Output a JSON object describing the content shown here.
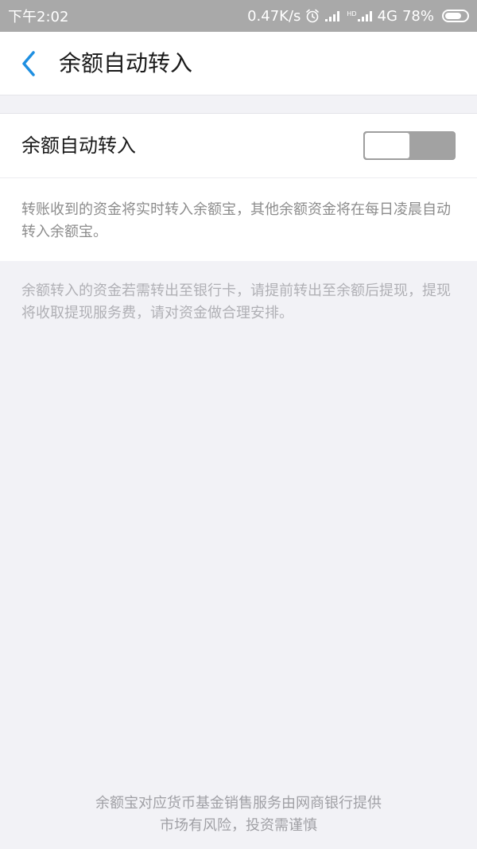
{
  "status_bar": {
    "time": "下午2:02",
    "network_speed": "0.47K/s",
    "alarm_icon": "alarm-icon",
    "signal_icon": "signal-icon",
    "hd_label": "HD",
    "network_type": "4G",
    "battery_percent": "78%",
    "battery_level": 0.78
  },
  "nav": {
    "back_icon": "chevron-left-icon",
    "title": "余额自动转入"
  },
  "settings": {
    "auto_transfer_label": "余额自动转入",
    "auto_transfer_enabled": false,
    "description": "转账收到的资金将实时转入余额宝，其他余额资金将在每日凌晨自动转入余额宝。"
  },
  "note": "余额转入的资金若需转出至银行卡，请提前转出至余额后提现，提现将收取提现服务费，请对资金做合理安排。",
  "footer": {
    "line1": "余额宝对应货币基金销售服务由网商银行提供",
    "line2": "市场有风险，投资需谨慎"
  },
  "colors": {
    "accent": "#1e8fe1",
    "status_bar_bg": "#a9a9a9",
    "page_bg": "#f2f2f6",
    "switch_off": "#a2a2a2"
  }
}
